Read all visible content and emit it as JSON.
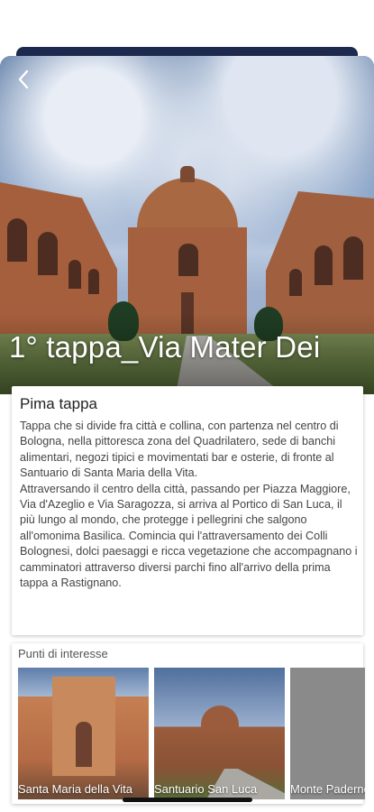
{
  "hero": {
    "title": "1° tappa_Via Mater Dei",
    "back_icon": "chevron-left-icon"
  },
  "description": {
    "title": "Pima tappa",
    "body": "Tappa che si divide fra città e collina, con partenza nel centro di Bologna, nella pittoresca zona del Quadrilatero, sede di banchi alimentari, negozi tipici e movimentati bar e osterie, di fronte al Santuario di Santa Maria della Vita.\nAttraversando il centro della città, passando per Piazza Maggiore, Via d'Azeglio e Via Saragozza, si arriva al Portico di San Luca, il più lungo al mondo, che protegge i pellegrini che salgono all'omonima Basilica. Comincia qui l'attraversamento dei Colli Bolognesi, dolci paesaggi e ricca vegetazione che accompagnano i camminatori attraverso diversi parchi fino all'arrivo della prima tappa a Rastignano."
  },
  "points_of_interest": {
    "title": "Punti di interesse",
    "items": [
      {
        "label": "Santa Maria della Vita"
      },
      {
        "label": "Santuario San Luca"
      },
      {
        "label": "Monte Paderno"
      }
    ]
  }
}
